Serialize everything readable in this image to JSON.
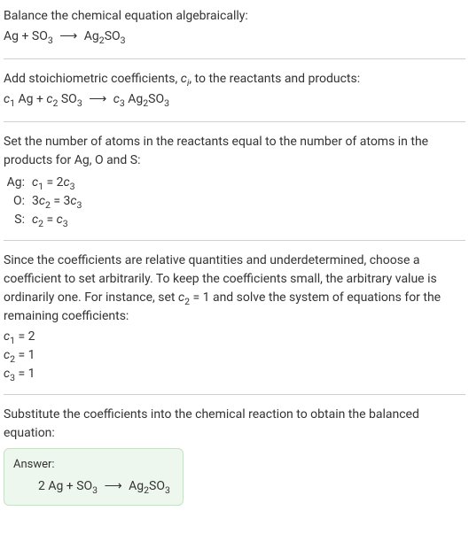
{
  "section1": {
    "line1": "Balance the chemical equation algebraically:",
    "eq_lhs1": "Ag + SO",
    "eq_sub1": "3",
    "eq_arrow": "⟶",
    "eq_rhs1": "Ag",
    "eq_rhs_sub1": "2",
    "eq_rhs2": "SO",
    "eq_rhs_sub2": "3"
  },
  "section2": {
    "line1_a": "Add stoichiometric coefficients, ",
    "line1_ci": "c",
    "line1_ci_sub": "i",
    "line1_b": ", to the reactants and products:",
    "c1": "c",
    "c1_sub": "1",
    "t1": " Ag + ",
    "c2": "c",
    "c2_sub": "2",
    "t2": " SO",
    "t2_sub": "3",
    "arrow": "⟶",
    "c3": "c",
    "c3_sub": "3",
    "t3": " Ag",
    "t3_sub1": "2",
    "t3b": "SO",
    "t3_sub2": "3"
  },
  "section3": {
    "line1": "Set the number of atoms in the reactants equal to the number of atoms in the products for Ag, O and S:",
    "rows": [
      {
        "label": "Ag:",
        "c_a": "c",
        "sub_a": "1",
        "mid": " = 2",
        "c_b": "c",
        "sub_b": "3"
      },
      {
        "label": "O:",
        "pre": "3",
        "c_a": "c",
        "sub_a": "2",
        "mid": " = 3",
        "c_b": "c",
        "sub_b": "3"
      },
      {
        "label": "S:",
        "c_a": "c",
        "sub_a": "2",
        "mid": " = ",
        "c_b": "c",
        "sub_b": "3"
      }
    ]
  },
  "section4": {
    "para_a": "Since the coefficients are relative quantities and underdetermined, choose a coefficient to set arbitrarily. To keep the coefficients small, the arbitrary value is ordinarily one. For instance, set ",
    "para_c": "c",
    "para_c_sub": "2",
    "para_b": " = 1 and solve the system of equations for the remaining coefficients:",
    "coeffs": [
      {
        "c": "c",
        "sub": "1",
        "val": " = 2"
      },
      {
        "c": "c",
        "sub": "2",
        "val": " = 1"
      },
      {
        "c": "c",
        "sub": "3",
        "val": " = 1"
      }
    ]
  },
  "section5": {
    "line1": "Substitute the coefficients into the chemical reaction to obtain the balanced equation:",
    "answer_label": "Answer:",
    "eq_a": "2 Ag + SO",
    "eq_a_sub": "3",
    "arrow": "⟶",
    "eq_b": "Ag",
    "eq_b_sub1": "2",
    "eq_c": "SO",
    "eq_c_sub": "3"
  }
}
